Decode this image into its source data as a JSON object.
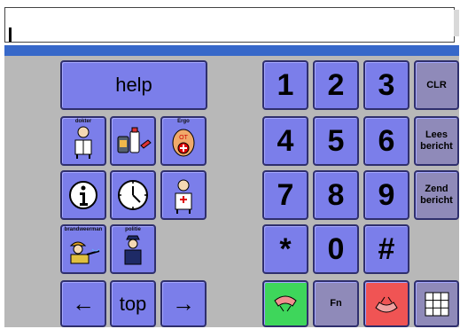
{
  "input": {
    "value": ""
  },
  "left_panel": {
    "help_label": "help",
    "icon_tiles": [
      {
        "caption": "dokter",
        "icon": "doctor-icon"
      },
      {
        "caption": "",
        "icon": "medicine-icon"
      },
      {
        "caption": "Ergo",
        "icon": "ergo-icon"
      },
      {
        "caption": "",
        "icon": "information-icon"
      },
      {
        "caption": "",
        "icon": "clock-icon"
      },
      {
        "caption": "",
        "icon": "nurse-icon"
      },
      {
        "caption": "brandweerman",
        "icon": "firefighter-icon"
      },
      {
        "caption": "politie",
        "icon": "police-icon"
      }
    ],
    "top_label": "top"
  },
  "keypad": {
    "keys": [
      "1",
      "2",
      "3",
      "4",
      "5",
      "6",
      "7",
      "8",
      "9",
      "*",
      "0",
      "#"
    ],
    "clr_label": "CLR",
    "lees_label": "Lees bericht",
    "zend_label": "Zend bericht",
    "fn_label": "Fn"
  },
  "colors": {
    "tile_blue": "#7b7eea",
    "answer_green": "#3ed65b",
    "hangup_red": "#f05454",
    "header_bar": "#3768c9",
    "panel_gray": "#b8b8b8"
  }
}
